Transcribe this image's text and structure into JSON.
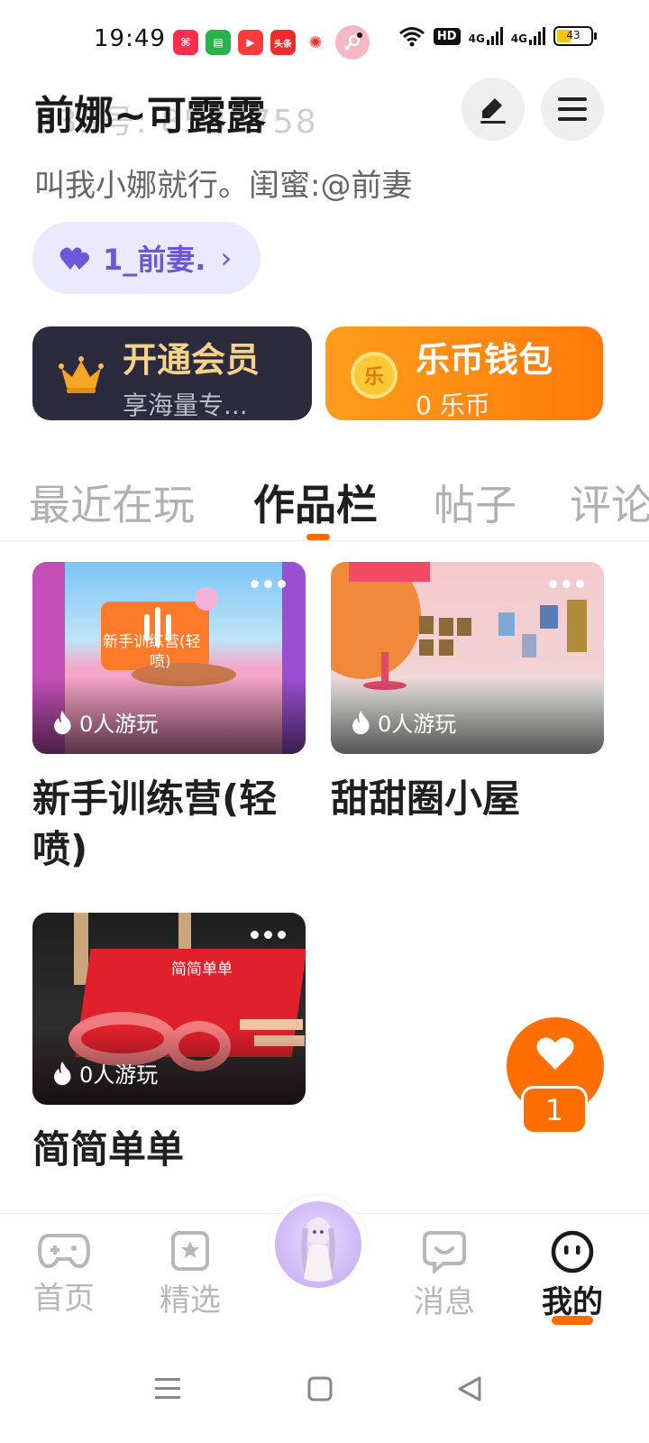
{
  "status_bar": {
    "time": "19:49",
    "app_icons": [
      {
        "name": "xiaohongshu-icon",
        "color": "#ff2e4d",
        "glyph": "⌘"
      },
      {
        "name": "wechat-icon",
        "color": "#2bb24c",
        "glyph": "▤"
      },
      {
        "name": "video-icon",
        "color": "#ff3b3b",
        "glyph": "▶"
      },
      {
        "name": "toutiao-icon",
        "color": "#ef2b2b",
        "glyph": "头条"
      },
      {
        "name": "weibo-icon",
        "color": "#ffffff",
        "glyph": "✺"
      }
    ],
    "hd_label": "HD",
    "signal_labels": [
      "4G",
      "4G"
    ],
    "battery_level": "43"
  },
  "profile": {
    "name": "前娜~可露露",
    "id_ghost": "233号: 8532758",
    "bio": "叫我小娜就行。闺蜜:@前妻",
    "fan_tag": "1_前妻.",
    "fan_tag_chevron": "›"
  },
  "vip_card": {
    "title": "开通会员",
    "subtitle": "享海量专..."
  },
  "wallet_card": {
    "title": "乐币钱包",
    "subtitle": "0 乐币",
    "coin_glyph": "乐"
  },
  "tabs": [
    {
      "label": "最近在玩",
      "active": false
    },
    {
      "label": "作品栏",
      "active": true
    },
    {
      "label": "帖子",
      "active": false
    },
    {
      "label": "评论",
      "active": false
    }
  ],
  "works": [
    {
      "title": "新手训练营(轻喷)",
      "plays": "0人游玩",
      "thumb_label": "新手训练营(轻",
      "thumb_label_2": "喷)"
    },
    {
      "title": "甜甜圈小屋",
      "plays": "0人游玩"
    },
    {
      "title": "简简单单",
      "plays": "0人游玩",
      "thumb_label": "简简单单"
    }
  ],
  "like_fab": {
    "count": "1"
  },
  "bottom_nav": [
    {
      "label": "首页",
      "icon": "gamepad-icon",
      "active": false
    },
    {
      "label": "精选",
      "icon": "star-bookmark-icon",
      "active": false
    },
    {
      "label": "消息",
      "icon": "chat-bubble-icon",
      "active": false
    },
    {
      "label": "我的",
      "icon": "face-icon",
      "active": true
    }
  ],
  "colors": {
    "accent": "#ff6a00",
    "vip_bg": "#2c2a3d",
    "wallet_bg": "#ff8a14",
    "fan_pill_bg": "#ebe9ff",
    "fan_pill_text": "#6b57d8"
  }
}
